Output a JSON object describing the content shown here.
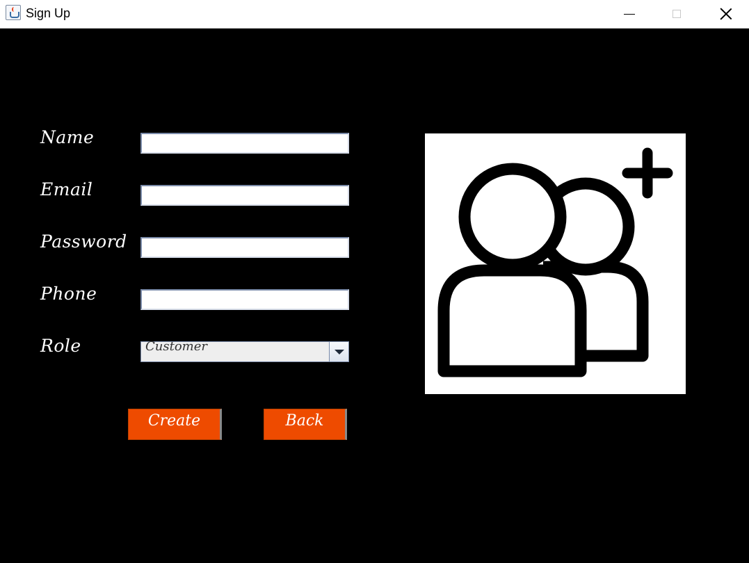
{
  "window": {
    "title": "Sign Up",
    "icon": "java-app-icon"
  },
  "form": {
    "name_label": "Name",
    "name_value": "",
    "email_label": "Email",
    "email_value": "",
    "password_label": "Password",
    "password_value": "",
    "phone_label": "Phone",
    "phone_value": "",
    "role_label": "Role",
    "role_selected": "Customer"
  },
  "buttons": {
    "create_label": "Create",
    "back_label": "Back"
  },
  "illustration": {
    "icon": "add-users-icon"
  },
  "colors": {
    "background": "#000000",
    "button_accent": "#ee4b00",
    "label_text": "#ffffff"
  }
}
